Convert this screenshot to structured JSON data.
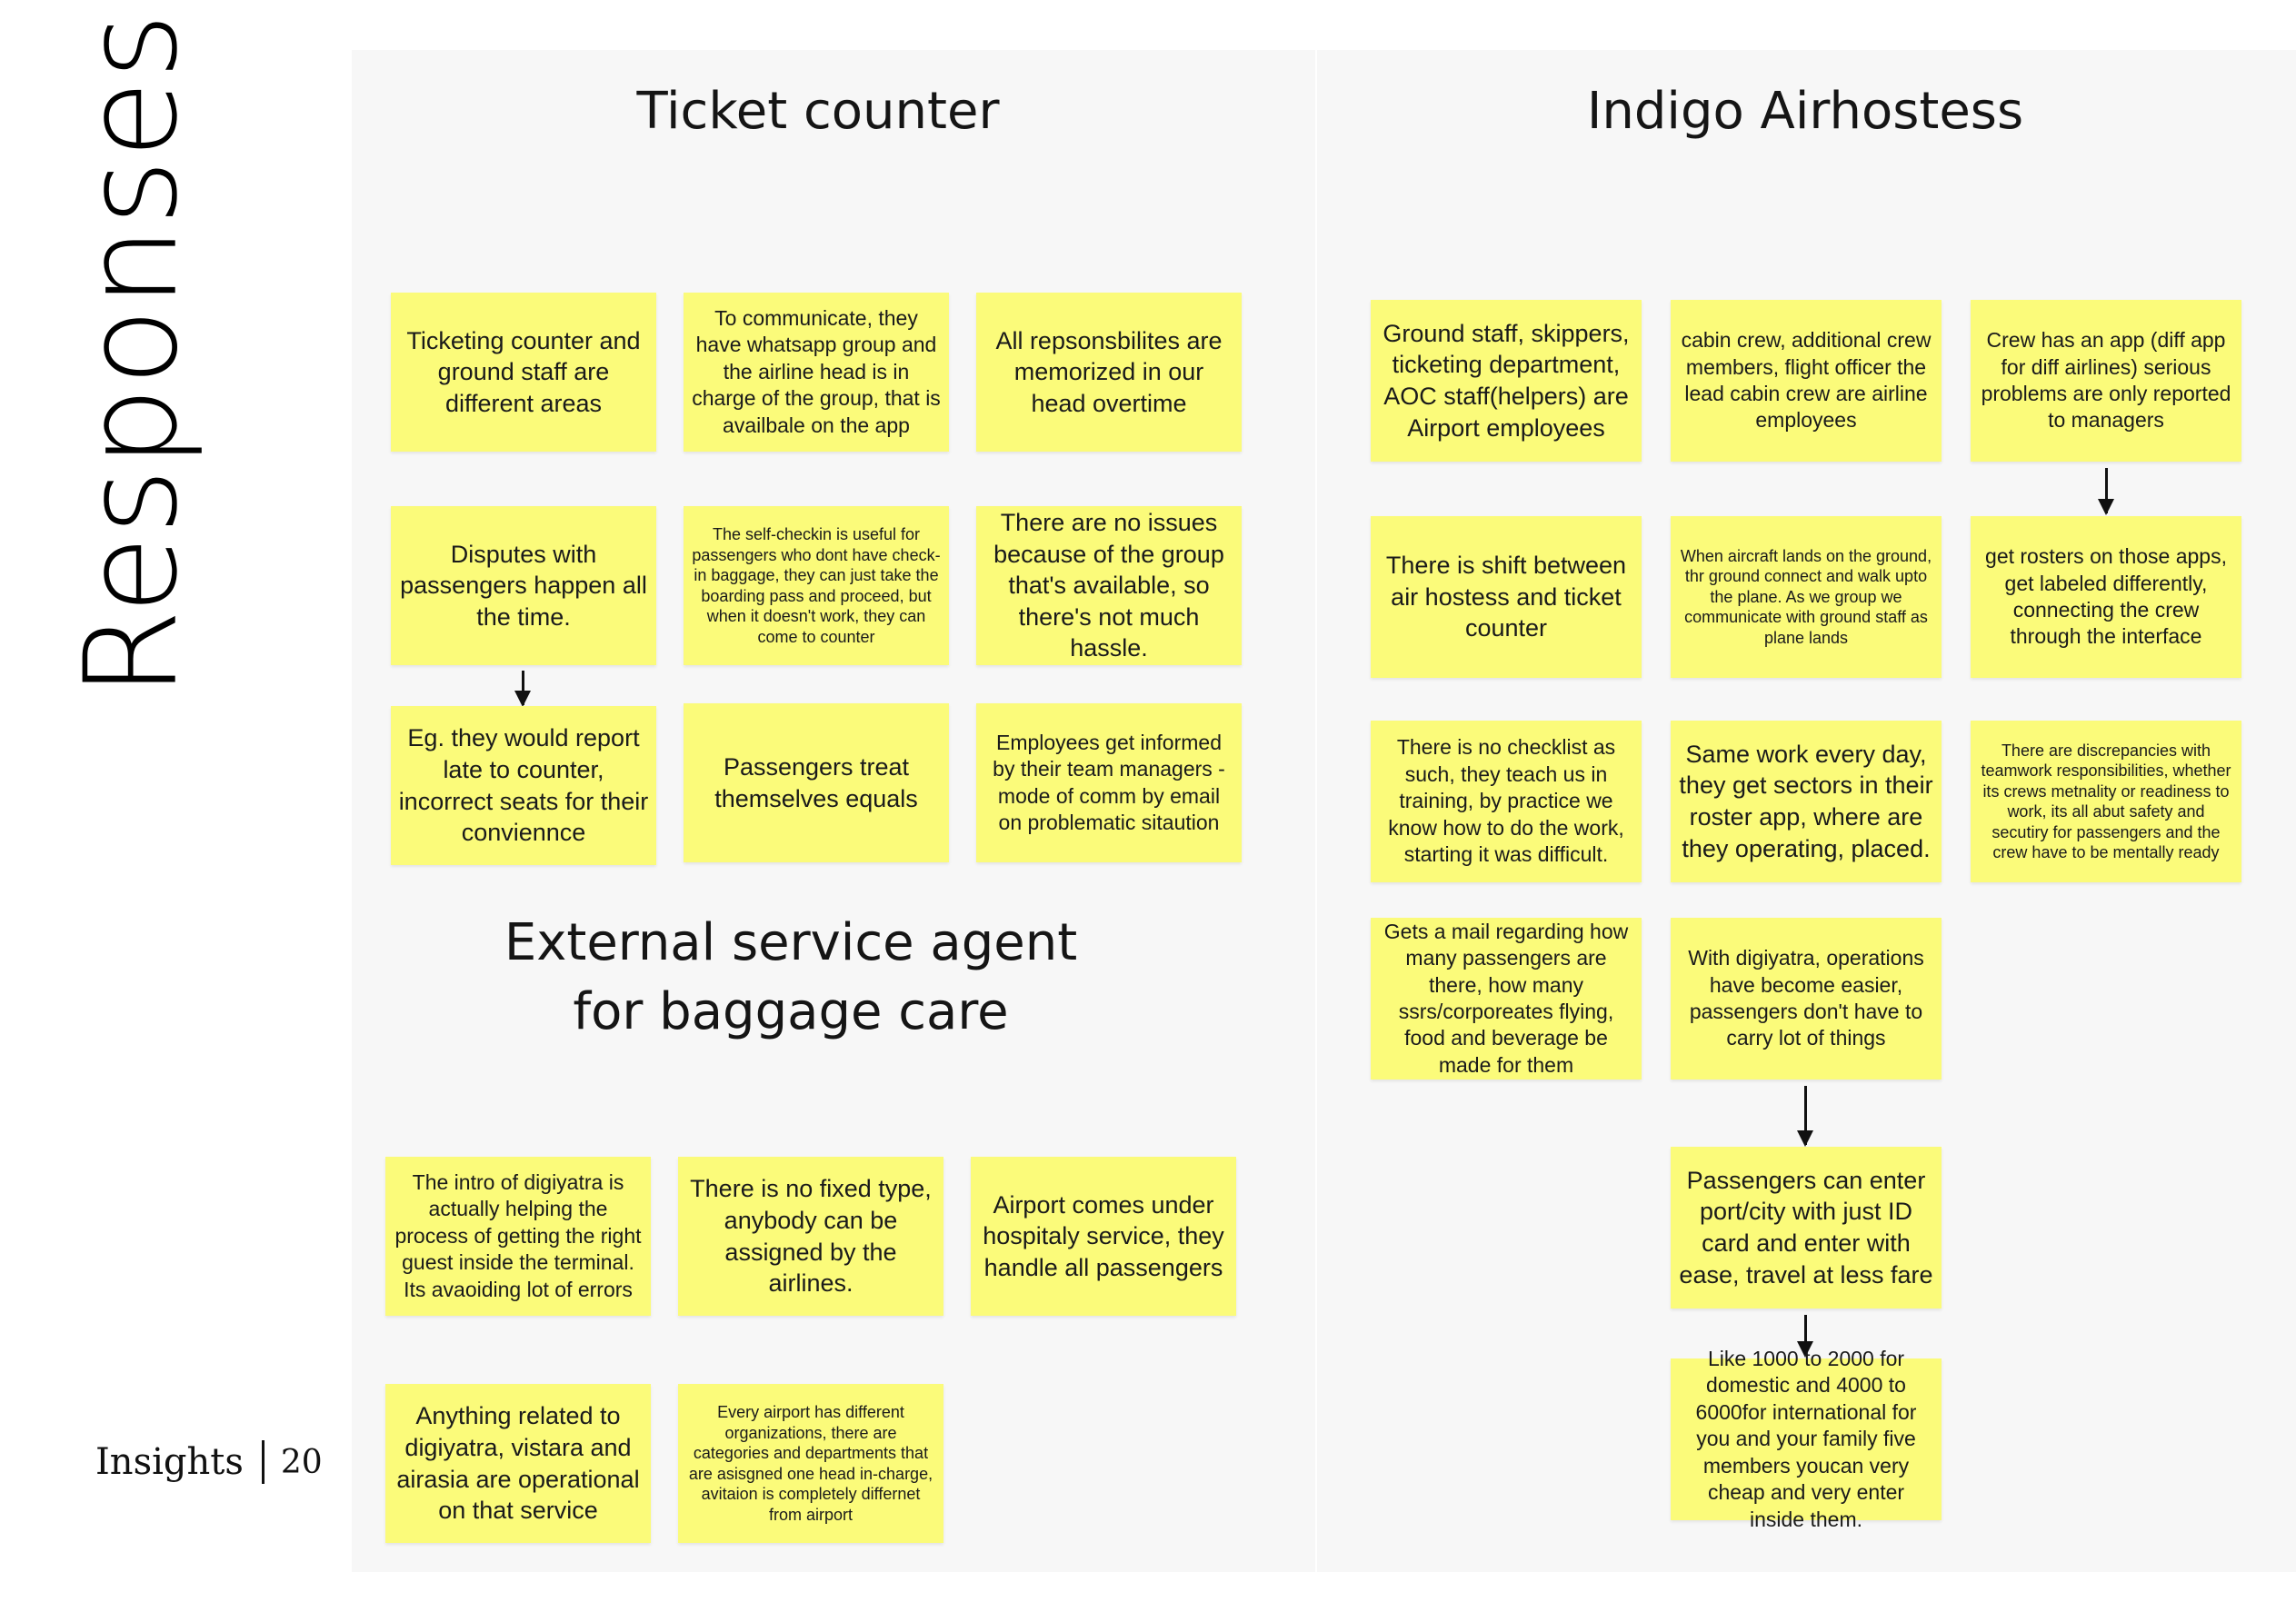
{
  "side_title": "Responses",
  "footer": {
    "label": "Insights",
    "page": "20"
  },
  "sections": {
    "ticket_counter": "Ticket counter",
    "external_agent_line1": "External service agent",
    "external_agent_line2": "for baggage care",
    "indigo": "Indigo Airhostess"
  },
  "notes": {
    "tc1": "Ticketing counter and ground staff are different areas",
    "tc2": "To communicate, they have whatsapp group and the airline head is in charge of the group, that is availbale on the app",
    "tc3": "All repsonsbilites are memorized in our head overtime",
    "tc4": "Disputes with passengers happen all the time.",
    "tc5": "The self-checkin is useful for passengers who dont have check-in baggage, they can just take the boarding pass and proceed, but when it doesn't work, they can come to counter",
    "tc6": "There are no issues because of the group that's available, so there's not much hassle.",
    "tc7": "Eg. they would report late to counter, incorrect seats for their conviennce",
    "tc8": "Passengers treat themselves equals",
    "tc9": "Employees get informed by their team managers - mode of comm by email on problematic sitaution",
    "ea1": "The intro of digiyatra is actually helping the process of getting the right guest inside the terminal. Its avaoiding lot of errors",
    "ea2": "There is no fixed type, anybody can be assigned by the airlines.",
    "ea3": "Airport comes under hospitaly service, they handle all passengers",
    "ea4": "Anything related to digiyatra, vistara and airasia are operational on that service",
    "ea5": "Every airport has  different organizations, there are categories and departments that are asisgned one head in-charge, avitaion is completely differnet from airport",
    "ia1": "Ground staff, skippers, ticketing department, AOC staff(helpers) are Airport employees",
    "ia2": "cabin crew, additional crew members, flight officer the lead cabin crew are airline employees",
    "ia3": "Crew has an app (diff app for diff airlines) serious problems are only reported to managers",
    "ia4": "There is shift between air hostess and ticket counter",
    "ia5": "When aircraft lands on the ground, thr ground connect and walk upto the plane. As we group we communicate with ground staff as plane lands",
    "ia6": "get rosters on those apps, get labeled differently, connecting the crew through the interface",
    "ia7": "There is no checklist as such, they teach us in training, by practice we know how to do the work, starting it was difficult.",
    "ia8": "Same work every day, they get sectors in their roster app, where are they operating, placed.",
    "ia9": "There are discrepancies with teamwork responsibilities, whether its crews metnality or readiness to work, its all abut safety and secutiry for passengers and the crew have to be mentally ready",
    "ia10": "Gets a mail regarding how many passengers are there, how many ssrs/corporeates flying, food and beverage be made for them",
    "ia11": "With digiyatra, operations have become easier, passengers don't have to carry lot of things",
    "ia12": "Passengers can enter port/city with just ID card and enter with ease, travel at less fare",
    "ia13": "Like 1000 to 2000 for domestic and 4000 to 6000for international for you and your family five members youcan very cheap and very enter inside them."
  },
  "colors": {
    "note": "#fbfb7a",
    "board": "#f7f7f7"
  }
}
